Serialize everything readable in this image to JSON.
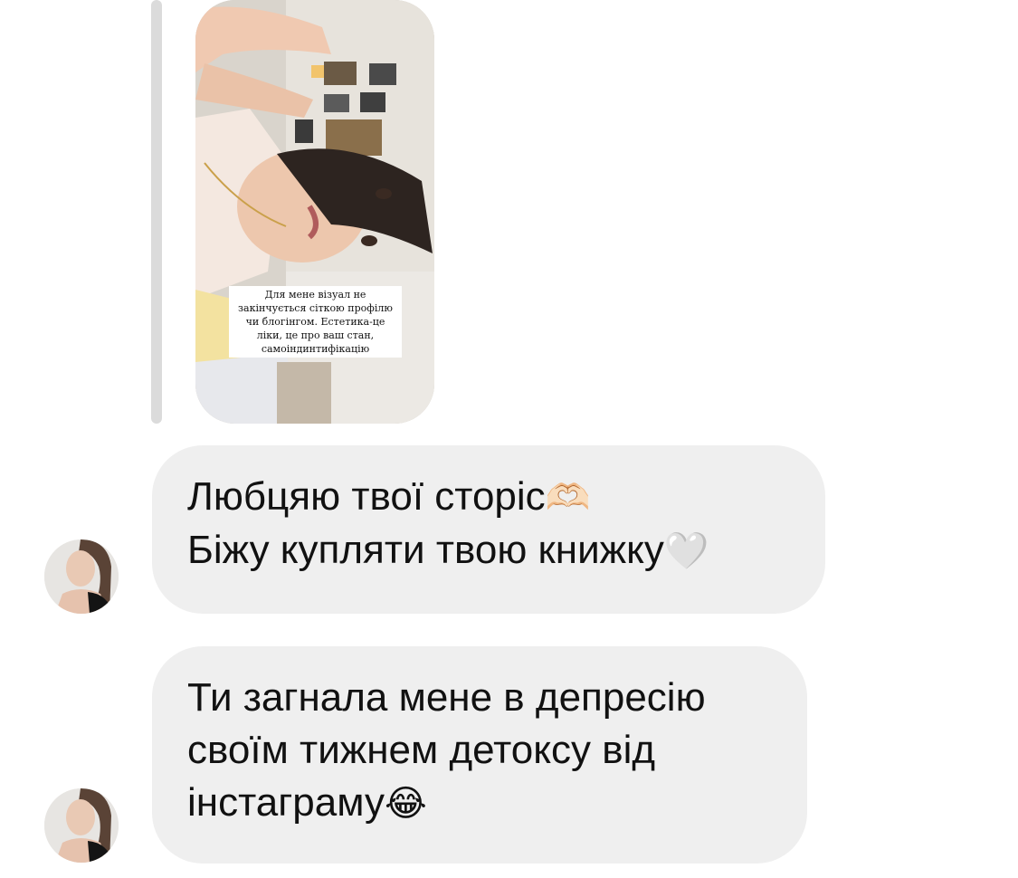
{
  "story_reply": {
    "caption": "Для мене візуал не закінчується сіткою профілю чи блогінгом. Естетика-це ліки, це про ваш стан, самоіндинтифікацію",
    "image_icon": "story-photo"
  },
  "messages": [
    {
      "lines": [
        "Любцяю твої сторіс",
        "Біжу купляти твою книжку"
      ],
      "emojis": [
        "🫶🏻",
        "🤍"
      ]
    },
    {
      "lines": [
        "Ти загнала мене в депресію",
        "своїм тижнем детоксу від",
        "інстаграму"
      ],
      "emojis": [
        "😂"
      ]
    }
  ],
  "avatar_icon": "profile-avatar",
  "colors": {
    "bubble_bg": "#efefef",
    "reply_bar": "#dbdbdb",
    "text": "#111111",
    "background": "#ffffff"
  }
}
